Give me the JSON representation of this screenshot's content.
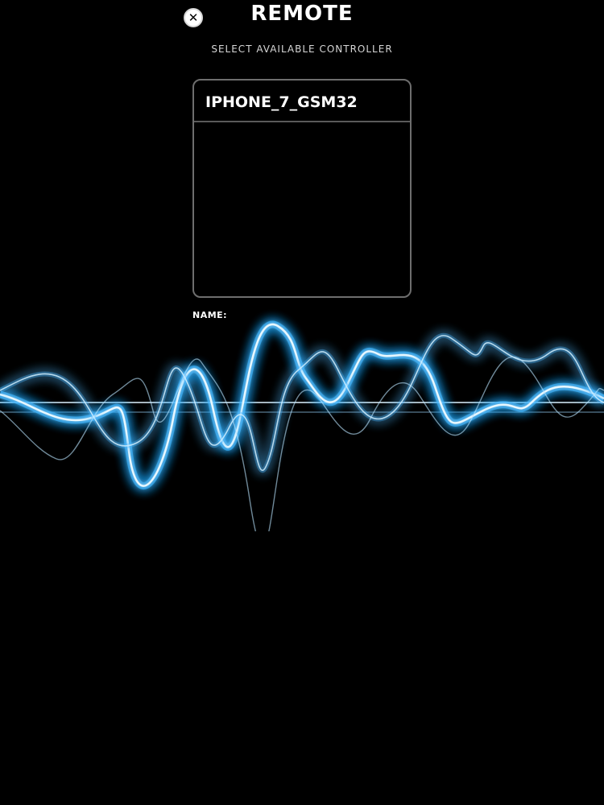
{
  "header": {
    "title": "REMOTE",
    "subtitle": "SELECT AVAILABLE CONTROLLER",
    "close_icon": "close-icon"
  },
  "controllers": {
    "items": [
      {
        "label": "IPHONE_7_GSM32"
      }
    ]
  },
  "name_field": {
    "label": "NAME:"
  },
  "colors": {
    "background": "#000000",
    "wave_glow": "#1aa8ff",
    "wave_line": "#e6f6ff",
    "list_border": "#6e6e6e"
  }
}
